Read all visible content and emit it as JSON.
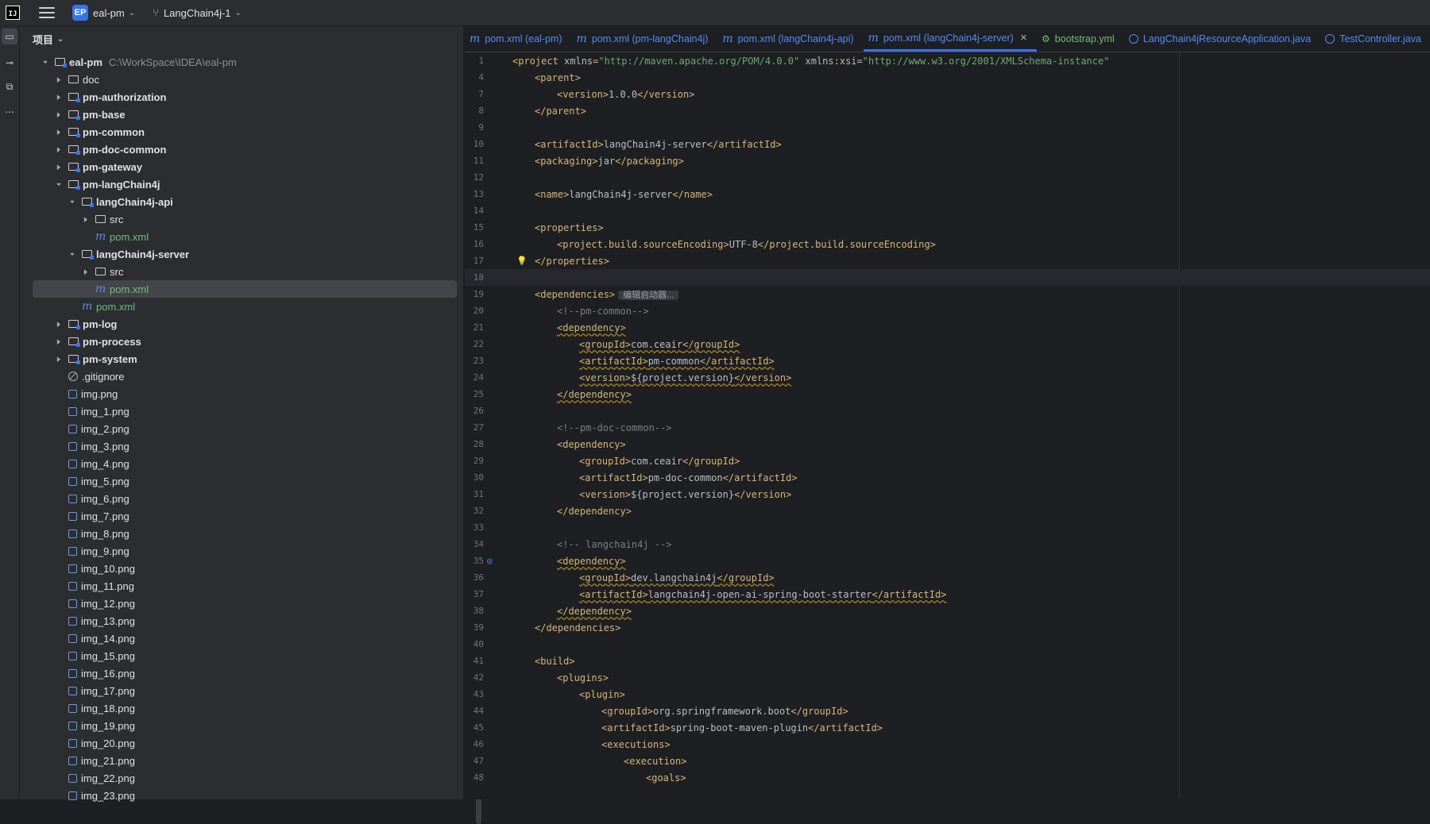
{
  "titlebar": {
    "project_badge": "EP",
    "project_name": "eal-pm",
    "branch": "LangChain4j-1"
  },
  "project_panel": {
    "header": "项目",
    "tree": [
      {
        "label": "eal-pm",
        "path": "C:\\WorkSpace\\IDEA\\eal-pm",
        "depth": 0,
        "arrow": "down",
        "icon": "module-folder",
        "bold": true
      },
      {
        "label": "doc",
        "depth": 1,
        "arrow": "right",
        "icon": "folder"
      },
      {
        "label": "pm-authorization",
        "depth": 1,
        "arrow": "right",
        "icon": "module-folder",
        "bold": true
      },
      {
        "label": "pm-base",
        "depth": 1,
        "arrow": "right",
        "icon": "module-folder",
        "bold": true
      },
      {
        "label": "pm-common",
        "depth": 1,
        "arrow": "right",
        "icon": "module-folder",
        "bold": true
      },
      {
        "label": "pm-doc-common",
        "depth": 1,
        "arrow": "right",
        "icon": "module-folder",
        "bold": true
      },
      {
        "label": "pm-gateway",
        "depth": 1,
        "arrow": "right",
        "icon": "module-folder",
        "bold": true
      },
      {
        "label": "pm-langChain4j",
        "depth": 1,
        "arrow": "down",
        "icon": "module-folder",
        "bold": true
      },
      {
        "label": "langChain4j-api",
        "depth": 2,
        "arrow": "down",
        "icon": "module-folder",
        "bold": true
      },
      {
        "label": "src",
        "depth": 3,
        "arrow": "right",
        "icon": "folder"
      },
      {
        "label": "pom.xml",
        "depth": 3,
        "arrow": "none",
        "icon": "maven",
        "green": true
      },
      {
        "label": "langChain4j-server",
        "depth": 2,
        "arrow": "down",
        "icon": "module-folder",
        "bold": true
      },
      {
        "label": "src",
        "depth": 3,
        "arrow": "right",
        "icon": "folder"
      },
      {
        "label": "pom.xml",
        "depth": 3,
        "arrow": "none",
        "icon": "maven",
        "green": true,
        "selected": true
      },
      {
        "label": "pom.xml",
        "depth": 2,
        "arrow": "none",
        "icon": "maven",
        "green": true
      },
      {
        "label": "pm-log",
        "depth": 1,
        "arrow": "right",
        "icon": "module-folder",
        "bold": true
      },
      {
        "label": "pm-process",
        "depth": 1,
        "arrow": "right",
        "icon": "module-folder",
        "bold": true
      },
      {
        "label": "pm-system",
        "depth": 1,
        "arrow": "right",
        "icon": "module-folder",
        "bold": true
      },
      {
        "label": ".gitignore",
        "depth": 1,
        "arrow": "none",
        "icon": "ignore"
      },
      {
        "label": "img.png",
        "depth": 1,
        "arrow": "none",
        "icon": "image"
      },
      {
        "label": "img_1.png",
        "depth": 1,
        "arrow": "none",
        "icon": "image"
      },
      {
        "label": "img_2.png",
        "depth": 1,
        "arrow": "none",
        "icon": "image"
      },
      {
        "label": "img_3.png",
        "depth": 1,
        "arrow": "none",
        "icon": "image"
      },
      {
        "label": "img_4.png",
        "depth": 1,
        "arrow": "none",
        "icon": "image"
      },
      {
        "label": "img_5.png",
        "depth": 1,
        "arrow": "none",
        "icon": "image"
      },
      {
        "label": "img_6.png",
        "depth": 1,
        "arrow": "none",
        "icon": "image"
      },
      {
        "label": "img_7.png",
        "depth": 1,
        "arrow": "none",
        "icon": "image"
      },
      {
        "label": "img_8.png",
        "depth": 1,
        "arrow": "none",
        "icon": "image"
      },
      {
        "label": "img_9.png",
        "depth": 1,
        "arrow": "none",
        "icon": "image"
      },
      {
        "label": "img_10.png",
        "depth": 1,
        "arrow": "none",
        "icon": "image"
      },
      {
        "label": "img_11.png",
        "depth": 1,
        "arrow": "none",
        "icon": "image"
      },
      {
        "label": "img_12.png",
        "depth": 1,
        "arrow": "none",
        "icon": "image"
      },
      {
        "label": "img_13.png",
        "depth": 1,
        "arrow": "none",
        "icon": "image"
      },
      {
        "label": "img_14.png",
        "depth": 1,
        "arrow": "none",
        "icon": "image"
      },
      {
        "label": "img_15.png",
        "depth": 1,
        "arrow": "none",
        "icon": "image"
      },
      {
        "label": "img_16.png",
        "depth": 1,
        "arrow": "none",
        "icon": "image"
      },
      {
        "label": "img_17.png",
        "depth": 1,
        "arrow": "none",
        "icon": "image"
      },
      {
        "label": "img_18.png",
        "depth": 1,
        "arrow": "none",
        "icon": "image"
      },
      {
        "label": "img_19.png",
        "depth": 1,
        "arrow": "none",
        "icon": "image"
      },
      {
        "label": "img_20.png",
        "depth": 1,
        "arrow": "none",
        "icon": "image"
      },
      {
        "label": "img_21.png",
        "depth": 1,
        "arrow": "none",
        "icon": "image"
      },
      {
        "label": "img_22.png",
        "depth": 1,
        "arrow": "none",
        "icon": "image"
      },
      {
        "label": "img_23.png",
        "depth": 1,
        "arrow": "none",
        "icon": "image"
      }
    ]
  },
  "editor": {
    "tabs": [
      {
        "label": "pom.xml (eal-pm)",
        "icon": "maven"
      },
      {
        "label": "pom.xml (pm-langChain4j)",
        "icon": "maven"
      },
      {
        "label": "pom.xml (langChain4j-api)",
        "icon": "maven"
      },
      {
        "label": "pom.xml (langChain4j-server)",
        "icon": "maven",
        "active": true
      },
      {
        "label": "bootstrap.yml",
        "icon": "yaml"
      },
      {
        "label": "LangChain4jResourceApplication.java",
        "icon": "class"
      },
      {
        "label": "TestController.java",
        "icon": "class"
      }
    ],
    "lines": [
      {
        "n": "1",
        "indent": 0,
        "parts": [
          [
            "tag",
            "<project "
          ],
          [
            "attr",
            "xmlns"
          ],
          [
            "tag",
            "="
          ],
          [
            "str",
            "\"http://maven.apache.org/POM/4.0.0\""
          ],
          [
            "attr",
            " xmlns"
          ],
          [
            "tag",
            ":"
          ],
          [
            "attr",
            "xsi"
          ],
          [
            "tag",
            "="
          ],
          [
            "str",
            "\"http://www.w3.org/2001/XMLSchema-instance\""
          ]
        ]
      },
      {
        "n": "4",
        "indent": 1,
        "parts": [
          [
            "tag",
            "<parent>"
          ]
        ]
      },
      {
        "n": "7",
        "indent": 2,
        "parts": [
          [
            "tag",
            "<version>"
          ],
          [
            "plain",
            "1.0.0"
          ],
          [
            "tag",
            "</version>"
          ]
        ]
      },
      {
        "n": "8",
        "indent": 1,
        "parts": [
          [
            "tag",
            "</parent>"
          ]
        ]
      },
      {
        "n": "9",
        "indent": 0,
        "parts": []
      },
      {
        "n": "10",
        "indent": 1,
        "parts": [
          [
            "tag",
            "<artifactId>"
          ],
          [
            "plain",
            "langChain4j-server"
          ],
          [
            "tag",
            "</artifactId>"
          ]
        ]
      },
      {
        "n": "11",
        "indent": 1,
        "parts": [
          [
            "tag",
            "<packaging>"
          ],
          [
            "plain",
            "jar"
          ],
          [
            "tag",
            "</packaging>"
          ]
        ]
      },
      {
        "n": "12",
        "indent": 0,
        "parts": []
      },
      {
        "n": "13",
        "indent": 1,
        "parts": [
          [
            "tag",
            "<name>"
          ],
          [
            "plain",
            "langChain4j-server"
          ],
          [
            "tag",
            "</name>"
          ]
        ]
      },
      {
        "n": "14",
        "indent": 0,
        "parts": []
      },
      {
        "n": "15",
        "indent": 1,
        "parts": [
          [
            "tag",
            "<properties>"
          ]
        ]
      },
      {
        "n": "16",
        "indent": 2,
        "parts": [
          [
            "tag",
            "<project.build.sourceEncoding>"
          ],
          [
            "plain",
            "UTF-8"
          ],
          [
            "tag",
            "</project.build.sourceEncoding>"
          ]
        ]
      },
      {
        "n": "17",
        "indent": 1,
        "parts": [
          [
            "tag",
            "</properties>"
          ]
        ],
        "bulb": true
      },
      {
        "n": "18",
        "indent": 0,
        "parts": [],
        "current": true
      },
      {
        "n": "19",
        "indent": 1,
        "parts": [
          [
            "tag",
            "<dependencies>"
          ]
        ],
        "hint": "编辑启动器..."
      },
      {
        "n": "20",
        "indent": 2,
        "parts": [
          [
            "cmt",
            "<!--pm-common-->"
          ]
        ]
      },
      {
        "n": "21",
        "indent": 2,
        "parts": [
          [
            "tag warn",
            "<dependency>"
          ]
        ]
      },
      {
        "n": "22",
        "indent": 3,
        "parts": [
          [
            "tag",
            "<groupId>"
          ],
          [
            "plain",
            "com.ceair"
          ],
          [
            "tag",
            "</groupId>"
          ]
        ],
        "warn": true
      },
      {
        "n": "23",
        "indent": 3,
        "parts": [
          [
            "tag",
            "<artifactId>"
          ],
          [
            "plain",
            "pm-common"
          ],
          [
            "tag",
            "</artifactId>"
          ]
        ],
        "warn": true
      },
      {
        "n": "24",
        "indent": 3,
        "parts": [
          [
            "tag",
            "<version>"
          ],
          [
            "plain",
            "${project.version}"
          ],
          [
            "tag",
            "</version>"
          ]
        ],
        "warn": true
      },
      {
        "n": "25",
        "indent": 2,
        "parts": [
          [
            "tag",
            "</dependency>"
          ]
        ],
        "warn": true
      },
      {
        "n": "26",
        "indent": 0,
        "parts": []
      },
      {
        "n": "27",
        "indent": 2,
        "parts": [
          [
            "cmt",
            "<!--pm-doc-common-->"
          ]
        ]
      },
      {
        "n": "28",
        "indent": 2,
        "parts": [
          [
            "tag",
            "<dependency>"
          ]
        ]
      },
      {
        "n": "29",
        "indent": 3,
        "parts": [
          [
            "tag",
            "<groupId>"
          ],
          [
            "plain",
            "com.ceair"
          ],
          [
            "tag",
            "</groupId>"
          ]
        ]
      },
      {
        "n": "30",
        "indent": 3,
        "parts": [
          [
            "tag",
            "<artifactId>"
          ],
          [
            "plain",
            "pm-doc-common"
          ],
          [
            "tag",
            "</artifactId>"
          ]
        ]
      },
      {
        "n": "31",
        "indent": 3,
        "parts": [
          [
            "tag",
            "<version>"
          ],
          [
            "plain",
            "${project.version}"
          ],
          [
            "tag",
            "</version>"
          ]
        ]
      },
      {
        "n": "32",
        "indent": 2,
        "parts": [
          [
            "tag",
            "</dependency>"
          ]
        ]
      },
      {
        "n": "33",
        "indent": 0,
        "parts": []
      },
      {
        "n": "34",
        "indent": 2,
        "parts": [
          [
            "cmt",
            "<!-- langchain4j -->"
          ]
        ]
      },
      {
        "n": "35",
        "indent": 2,
        "parts": [
          [
            "tag warn",
            "<dependency>"
          ]
        ],
        "mark": true
      },
      {
        "n": "36",
        "indent": 3,
        "parts": [
          [
            "tag",
            "<groupId>"
          ],
          [
            "plain",
            "dev.langchain4j"
          ],
          [
            "tag",
            "</groupId>"
          ]
        ],
        "warn": true
      },
      {
        "n": "37",
        "indent": 3,
        "parts": [
          [
            "tag",
            "<artifactId>"
          ],
          [
            "plain",
            "langchain4j-open-ai-spring-boot-starter"
          ],
          [
            "tag",
            "</artifactId>"
          ]
        ],
        "warn": true
      },
      {
        "n": "38",
        "indent": 2,
        "parts": [
          [
            "tag",
            "</dependency>"
          ]
        ],
        "warn": true
      },
      {
        "n": "39",
        "indent": 1,
        "parts": [
          [
            "tag",
            "</dependencies>"
          ]
        ]
      },
      {
        "n": "40",
        "indent": 0,
        "parts": []
      },
      {
        "n": "41",
        "indent": 1,
        "parts": [
          [
            "tag",
            "<build>"
          ]
        ]
      },
      {
        "n": "42",
        "indent": 2,
        "parts": [
          [
            "tag",
            "<plugins>"
          ]
        ]
      },
      {
        "n": "43",
        "indent": 3,
        "parts": [
          [
            "tag",
            "<plugin>"
          ]
        ]
      },
      {
        "n": "44",
        "indent": 4,
        "parts": [
          [
            "tag",
            "<groupId>"
          ],
          [
            "plain",
            "org.springframework.boot"
          ],
          [
            "tag",
            "</groupId>"
          ]
        ]
      },
      {
        "n": "45",
        "indent": 4,
        "parts": [
          [
            "tag",
            "<artifactId>"
          ],
          [
            "plain",
            "spring-boot-maven-plugin"
          ],
          [
            "tag",
            "</artifactId>"
          ]
        ]
      },
      {
        "n": "46",
        "indent": 4,
        "parts": [
          [
            "tag",
            "<executions>"
          ]
        ]
      },
      {
        "n": "47",
        "indent": 5,
        "parts": [
          [
            "tag",
            "<execution>"
          ]
        ]
      },
      {
        "n": "48",
        "indent": 6,
        "parts": [
          [
            "tag",
            "<goals>"
          ]
        ]
      }
    ]
  }
}
